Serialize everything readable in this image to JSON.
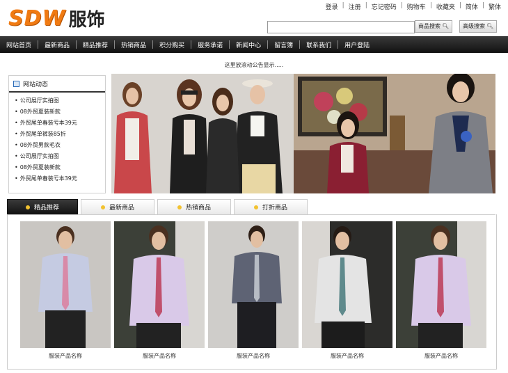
{
  "logo": {
    "brand": "SDW",
    "cn": "服饰"
  },
  "toplinks": [
    "登录",
    "注册",
    "忘记密码",
    "购物车",
    "收藏夹",
    "简体",
    "繁体"
  ],
  "search": {
    "placeholder": "",
    "btn_product": "商品搜索",
    "btn_advanced": "高级搜索"
  },
  "nav": [
    "网站首页",
    "最新商品",
    "精品推荐",
    "热销商品",
    "积分购买",
    "服务承诺",
    "新闻中心",
    "留言簿",
    "联系我们",
    "用户登陆"
  ],
  "notice": "这里放滚动公告显示.....",
  "news": {
    "title": "网站动态",
    "items": [
      "公司展厅实拍图",
      "08外贸夏装新款",
      "外贸尾单春装亏本39元",
      "外贸尾单裤装85折",
      "08外贸男款毛衣",
      "公司展厅实拍图",
      "08外贸夏装新款",
      "外贸尾单春装亏本39元"
    ]
  },
  "tabs": [
    "精品推荐",
    "最新商品",
    "热销商品",
    "打折商品"
  ],
  "products": [
    {
      "name": "服装产品名称",
      "shirt": "#c5cbe2",
      "tie": "#d88aa8",
      "bg": "#c9c6c2"
    },
    {
      "name": "服装产品名称",
      "shirt": "#d9c9e8",
      "tie": "#c0506c",
      "bg": "#3c4038"
    },
    {
      "name": "服装产品名称",
      "shirt": "#5e6374",
      "tie": "#b7bcc4",
      "bg": "#cfcdca"
    },
    {
      "name": "服装产品名称",
      "shirt": "#e4e4e4",
      "tie": "#5f8a8c",
      "bg": "#2c2c2a"
    },
    {
      "name": "服装产品名称",
      "shirt": "#d9c9e8",
      "tie": "#c0506c",
      "bg": "#3c4038"
    }
  ]
}
